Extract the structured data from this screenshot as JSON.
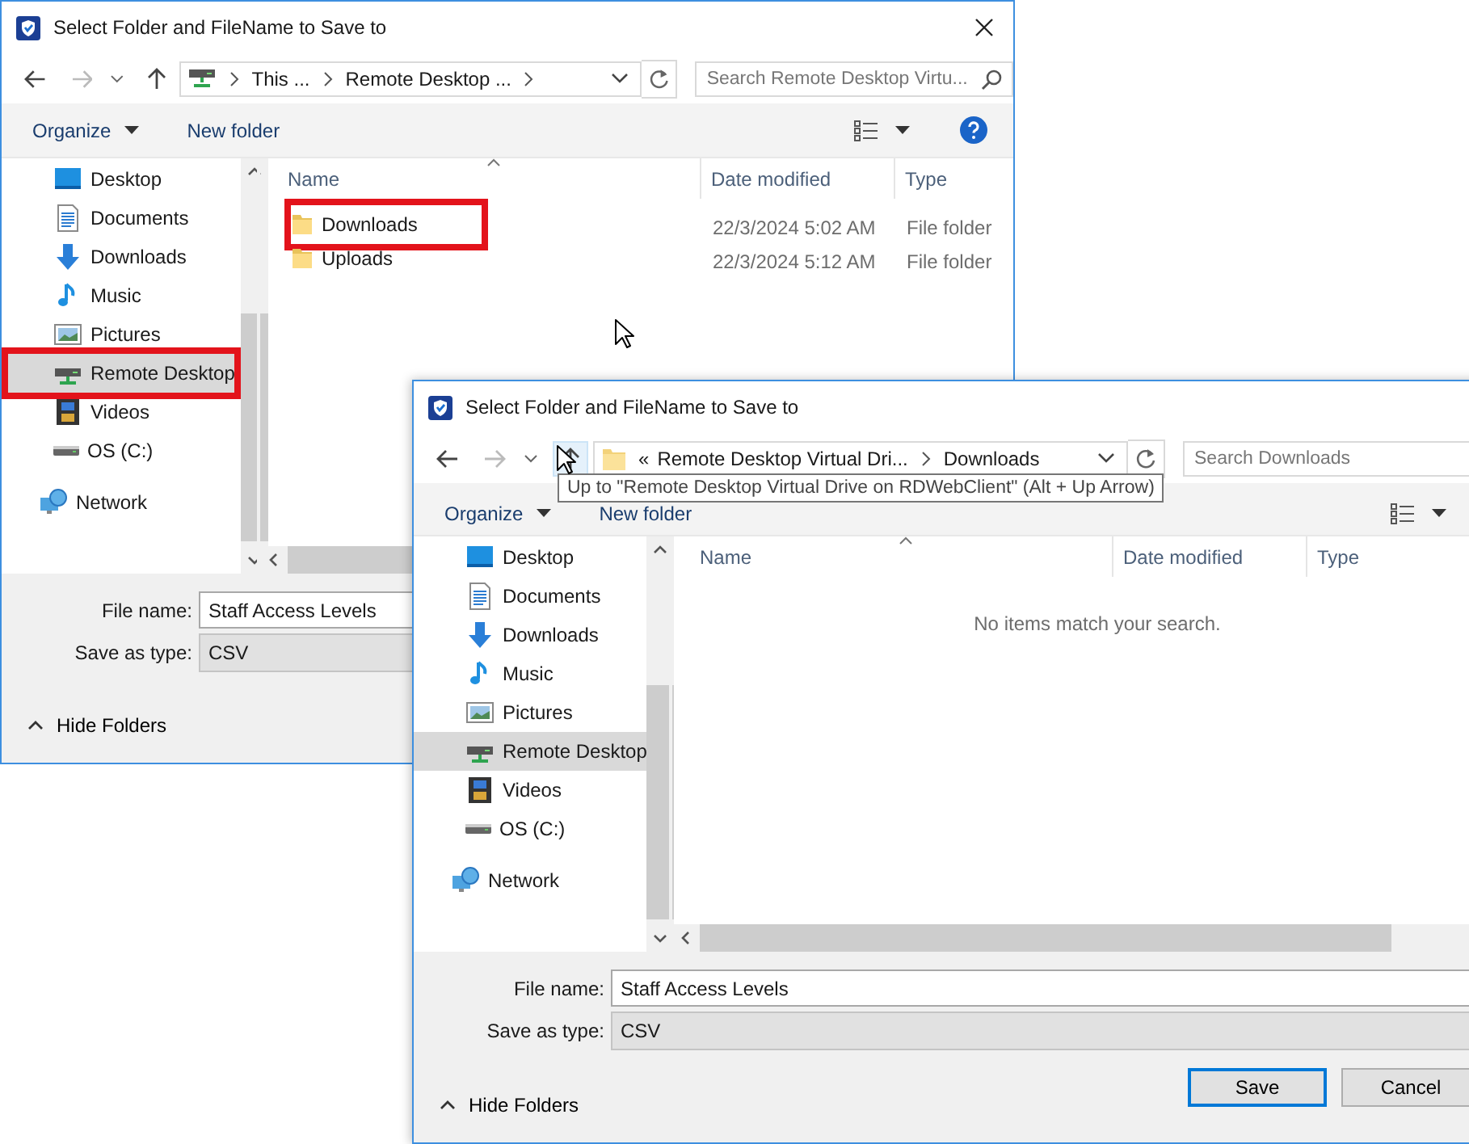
{
  "dialogs": [
    {
      "title": "Select Folder and FileName to Save to",
      "close_visible": true,
      "help_visible": true,
      "nav": {
        "up_hovered": false
      },
      "address": {
        "lead_chevron": true,
        "segments": [
          {
            "text": "This ...",
            "chevron_after": true
          },
          {
            "text": "Remote Desktop ...",
            "chevron_after": true
          }
        ]
      },
      "search": {
        "placeholder": "Search Remote Desktop Virtu..."
      },
      "toolbar": {
        "organize": "Organize",
        "new_folder": "New folder"
      },
      "sidebar": {
        "items": [
          {
            "label": "Desktop",
            "kind": "desktop",
            "selected": false,
            "highlighted": false
          },
          {
            "label": "Documents",
            "kind": "documents",
            "selected": false,
            "highlighted": false
          },
          {
            "label": "Downloads",
            "kind": "downloads",
            "selected": false,
            "highlighted": false
          },
          {
            "label": "Music",
            "kind": "music",
            "selected": false,
            "highlighted": false
          },
          {
            "label": "Pictures",
            "kind": "pictures",
            "selected": false,
            "highlighted": false
          },
          {
            "label": "Remote Desktop",
            "kind": "remote",
            "selected": true,
            "highlighted": true
          },
          {
            "label": "Videos",
            "kind": "videos",
            "selected": false,
            "highlighted": false
          },
          {
            "label": "OS (C:)",
            "kind": "drive",
            "selected": false,
            "highlighted": false
          },
          {
            "label": "Network",
            "kind": "network",
            "selected": false,
            "highlighted": false
          }
        ]
      },
      "columns": [
        "Name",
        "Date modified",
        "Type"
      ],
      "rows": [
        {
          "name": "Downloads",
          "date_modified": "22/3/2024 5:02 AM",
          "type": "File folder",
          "highlighted": true
        },
        {
          "name": "Uploads",
          "date_modified": "22/3/2024 5:12 AM",
          "type": "File folder",
          "highlighted": false
        }
      ],
      "file_name": {
        "label": "File name:",
        "value": "Staff Access Levels"
      },
      "save_as_type": {
        "label": "Save as type:",
        "value": "CSV"
      },
      "hide_folders": "Hide Folders"
    },
    {
      "title": "Select Folder and FileName to Save to",
      "close_visible": false,
      "help_visible": false,
      "nav": {
        "up_hovered": true
      },
      "address": {
        "lead_chevron": false,
        "overflow_mark": "«",
        "segments": [
          {
            "text": "Remote Desktop Virtual Dri...",
            "chevron_after": true
          },
          {
            "text": "Downloads",
            "chevron_after": false
          }
        ]
      },
      "search": {
        "placeholder": "Search Downloads"
      },
      "toolbar": {
        "organize": "Organize",
        "new_folder": "New folder"
      },
      "tooltip": "Up to \"Remote Desktop Virtual Drive on RDWebClient\" (Alt + Up Arrow)",
      "sidebar": {
        "items": [
          {
            "label": "Desktop",
            "kind": "desktop",
            "selected": false,
            "highlighted": false
          },
          {
            "label": "Documents",
            "kind": "documents",
            "selected": false,
            "highlighted": false
          },
          {
            "label": "Downloads",
            "kind": "downloads",
            "selected": false,
            "highlighted": false
          },
          {
            "label": "Music",
            "kind": "music",
            "selected": false,
            "highlighted": false
          },
          {
            "label": "Pictures",
            "kind": "pictures",
            "selected": false,
            "highlighted": false
          },
          {
            "label": "Remote Desktop",
            "kind": "remote",
            "selected": true,
            "highlighted": false
          },
          {
            "label": "Videos",
            "kind": "videos",
            "selected": false,
            "highlighted": false
          },
          {
            "label": "OS (C:)",
            "kind": "drive",
            "selected": false,
            "highlighted": false
          },
          {
            "label": "Network",
            "kind": "network",
            "selected": false,
            "highlighted": false
          }
        ]
      },
      "columns": [
        "Name",
        "Date modified",
        "Type"
      ],
      "empty_message": "No items match your search.",
      "file_name": {
        "label": "File name:",
        "value": "Staff Access Levels"
      },
      "save_as_type": {
        "label": "Save as type:",
        "value": "CSV"
      },
      "hide_folders": "Hide Folders",
      "buttons": [
        {
          "label": "Save",
          "default": true
        },
        {
          "label": "Cancel",
          "default": false
        }
      ]
    }
  ]
}
